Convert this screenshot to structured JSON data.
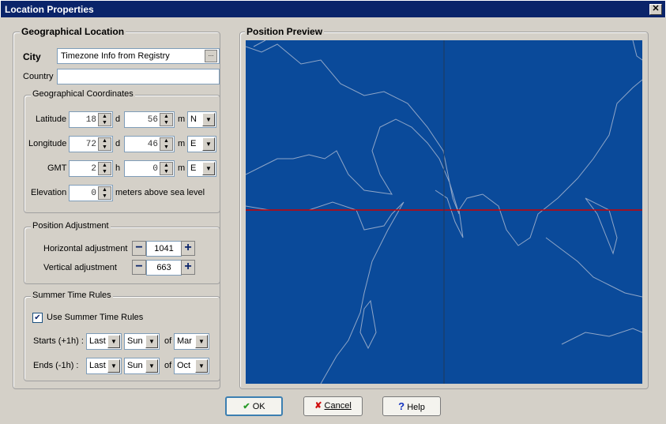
{
  "window": {
    "title": "Location Properties",
    "close": "✕"
  },
  "geo": {
    "title": "Geographical Location",
    "city_label": "City",
    "city_value": "Timezone Info from Registry",
    "city_browse": "...",
    "country_label": "Country",
    "country_value": ""
  },
  "coords": {
    "title": "Geographical Coordinates",
    "latitude": {
      "label": "Latitude",
      "deg": "18",
      "deg_unit": "d",
      "min": "56",
      "min_unit": "m",
      "dir": "N"
    },
    "longitude": {
      "label": "Longitude",
      "deg": "72",
      "deg_unit": "d",
      "min": "46",
      "min_unit": "m",
      "dir": "E"
    },
    "gmt": {
      "label": "GMT",
      "hours": "2",
      "hours_unit": "h",
      "min": "0",
      "min_unit": "m",
      "dir": "E"
    },
    "elevation": {
      "label": "Elevation",
      "value": "0",
      "unit": "meters above sea level"
    }
  },
  "adjust": {
    "title": "Position Adjustment",
    "horizontal_label": "Horizontal adjustment",
    "horizontal": "1041",
    "vertical_label": "Vertical adjustment",
    "vertical": "663",
    "minus": "−",
    "plus": "+"
  },
  "summer": {
    "title": "Summer Time Rules",
    "use_label": "Use Summer Time Rules",
    "use_checked": true,
    "starts_label": "Starts (+1h) :",
    "starts": [
      "Last",
      "Sun",
      "Mar"
    ],
    "ends_label": "Ends (-1h) :",
    "ends": [
      "Last",
      "Sun",
      "Oct"
    ],
    "of": "of"
  },
  "preview": {
    "title": "Position Preview",
    "map_color": "#0a4a9a",
    "marker_color": "#cc0000"
  },
  "buttons": {
    "ok": "OK",
    "cancel": "Cancel",
    "help": "Help"
  }
}
